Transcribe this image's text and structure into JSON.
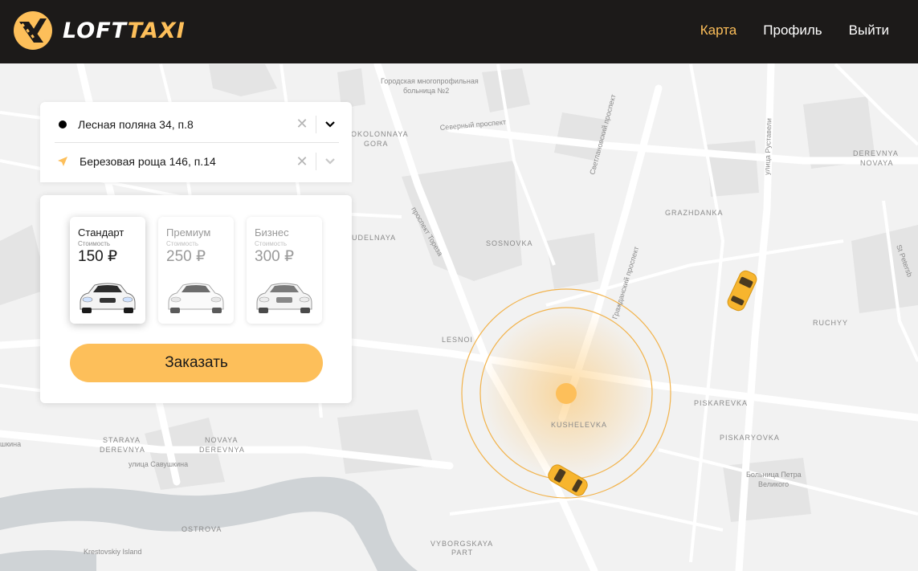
{
  "app": {
    "logo_part1": "LOFT",
    "logo_part2": "TAXI"
  },
  "nav": [
    {
      "label": "Карта",
      "active": true
    },
    {
      "label": "Профиль",
      "active": false
    },
    {
      "label": "Выйти",
      "active": false
    }
  ],
  "route": {
    "from": "Лесная поляна 34, п.8",
    "to": "Березовая роща 146, п.14"
  },
  "tariffs": [
    {
      "name": "Стандарт",
      "cost_label": "Стоимость",
      "price": "150 ₽",
      "selected": true
    },
    {
      "name": "Премиум",
      "cost_label": "Стоимость",
      "price": "250 ₽",
      "selected": false
    },
    {
      "name": "Бизнес",
      "cost_label": "Стоимость",
      "price": "300 ₽",
      "selected": false
    }
  ],
  "order_button": "Заказать",
  "map_labels": {
    "hospital": [
      "Городская многопрофильная",
      "больница №2"
    ],
    "severny": "Северный проспект",
    "okolonnaya": [
      "OKOLONNAYA",
      "GORA"
    ],
    "svetlanovsky": "Светлановский проспект",
    "rustaveli": "улица Руставели",
    "derevnya_novaya": [
      "DEREVNYA",
      "NOVAYA"
    ],
    "grazhdanka": "GRAZHDANKA",
    "toreza": "проспект Тореза",
    "sosnovka": "SOSNOVKA",
    "udelnaya": "UDELNAYA",
    "grazhdansky": "Гражданский проспект",
    "lesnoi": "LESNOI",
    "ruchyy": "RUCHYY",
    "piskarevka": "PISKAREVKA",
    "kushelevka": "KUSHELEVKA",
    "piskaryovka": "PISKARYOVKA",
    "staraya": [
      "STARAYA",
      "DEREVNYA"
    ],
    "novaya": [
      "NOVAYA",
      "DEREVNYA"
    ],
    "savushkina": "улица Савушкина",
    "petra": [
      "Больница Петра",
      "Великого"
    ],
    "ostrova": "OSTROVA",
    "krestovsky": "Krestovskiy Island",
    "vyborgskaya": [
      "VYBORGSKAYA",
      "PART"
    ],
    "shkina": "шкина",
    "st_peter": "St Petersb"
  },
  "colors": {
    "accent": "#fdbf5a",
    "header_bg": "#1c1a19",
    "map_bg": "#f2f2f2",
    "water": "#cfd3d6"
  }
}
